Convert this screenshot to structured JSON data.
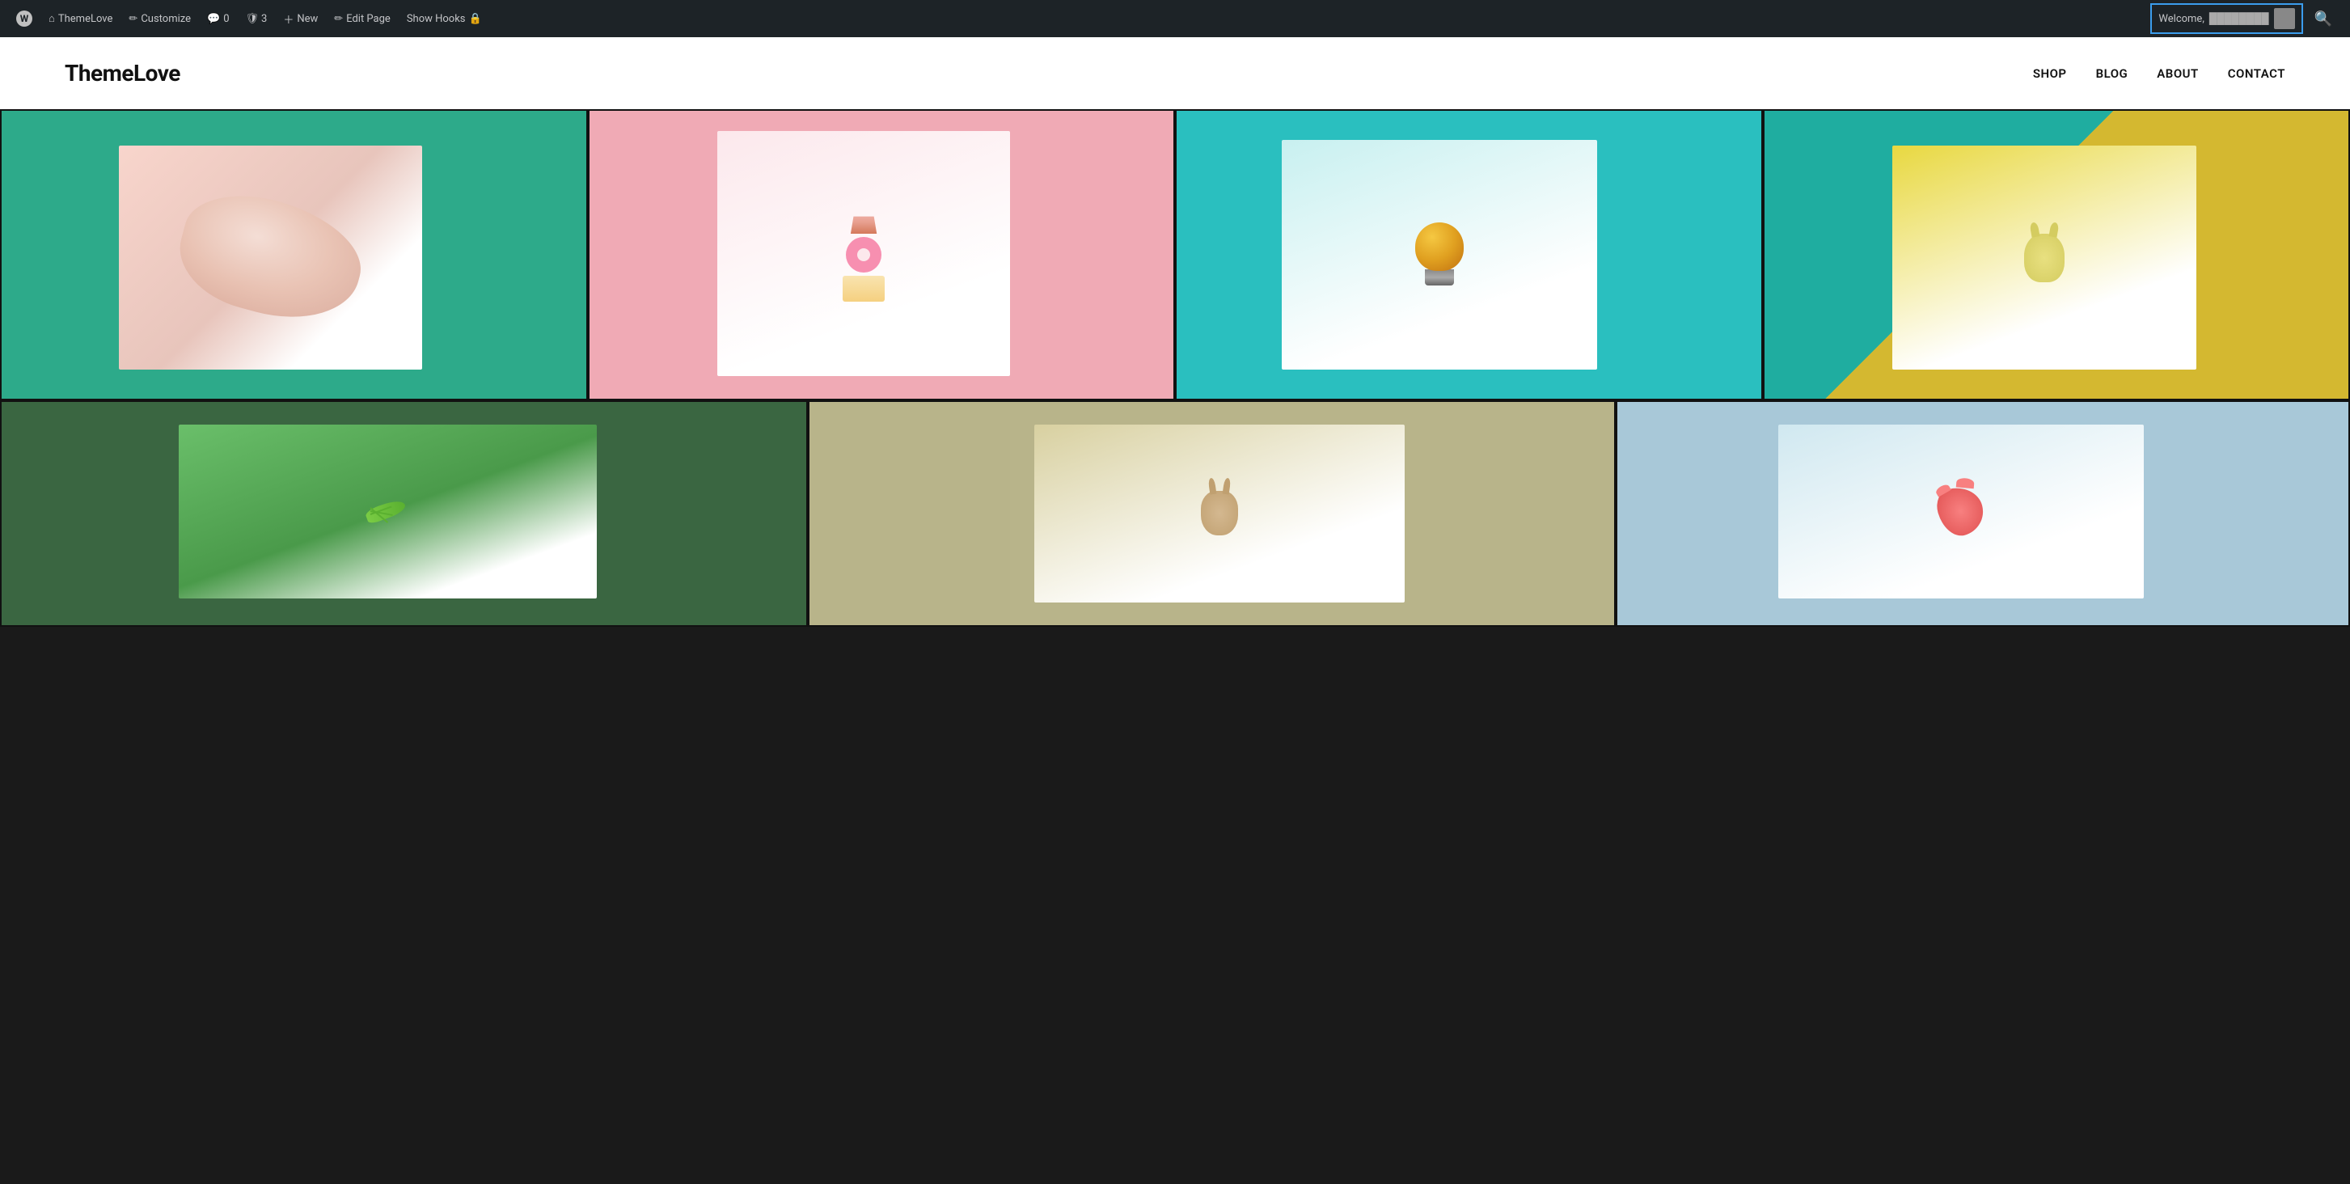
{
  "adminBar": {
    "items": [
      {
        "id": "wp-logo",
        "label": "WordPress",
        "icon": "wp"
      },
      {
        "id": "themelove",
        "label": "ThemeLove",
        "icon": "site"
      },
      {
        "id": "customize",
        "label": "Customize",
        "icon": "pencil"
      },
      {
        "id": "comments",
        "label": "0",
        "icon": "comment"
      },
      {
        "id": "security",
        "label": "3",
        "icon": "shield"
      },
      {
        "id": "new",
        "label": "New",
        "icon": "plus"
      },
      {
        "id": "edit-page",
        "label": "Edit Page",
        "icon": "pencil"
      },
      {
        "id": "show-hooks",
        "label": "Show Hooks",
        "icon": "hook"
      }
    ],
    "welcome": {
      "label": "Welcome,",
      "username": "••••••••"
    }
  },
  "siteHeader": {
    "title": "ThemeLove",
    "nav": [
      {
        "id": "shop",
        "label": "SHOP"
      },
      {
        "id": "blog",
        "label": "BLOG"
      },
      {
        "id": "about",
        "label": "ABOUT"
      },
      {
        "id": "contact",
        "label": "CONTACT"
      }
    ]
  },
  "gallery": {
    "row1": [
      {
        "id": "cell-1",
        "bg": "bg-teal",
        "alt": "Pink stone on teal background"
      },
      {
        "id": "cell-2",
        "bg": "bg-pink",
        "alt": "Sweets and donut on pink background"
      },
      {
        "id": "cell-3",
        "bg": "bg-cyan",
        "alt": "Light bulb on cyan background"
      },
      {
        "id": "cell-4",
        "bg": "bg-teal2",
        "alt": "Goat figurine on yellow teal background"
      }
    ],
    "row2": [
      {
        "id": "cell-5",
        "bg": "bg-green",
        "alt": "Grasshopper on green background"
      },
      {
        "id": "cell-6",
        "bg": "bg-khaki",
        "alt": "Deer head on khaki background"
      },
      {
        "id": "cell-7",
        "bg": "bg-lightblue",
        "alt": "Pink animal on light blue background"
      }
    ]
  }
}
